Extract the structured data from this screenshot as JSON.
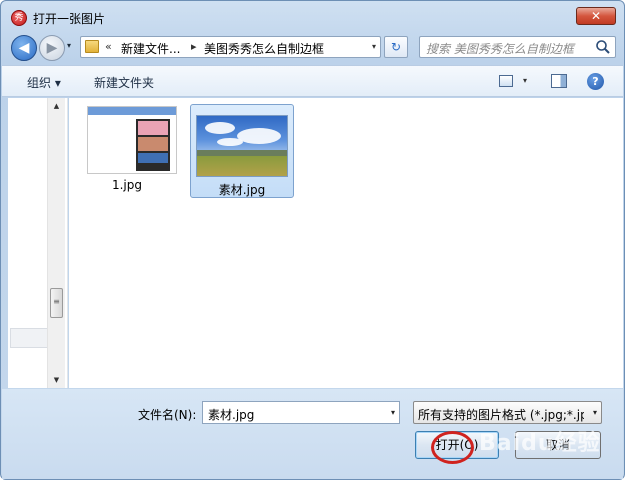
{
  "window": {
    "title": "打开一张图片",
    "close_label": "✕",
    "app_icon_glyph": "秀"
  },
  "nav": {
    "back_glyph": "◀",
    "forward_glyph": "▶",
    "dropdown_glyph": "▾"
  },
  "address": {
    "overflow_glyph": "«",
    "crumbs": [
      "新建文件...",
      "美图秀秀怎么自制边框"
    ],
    "separator_glyph": "▸",
    "dropdown_glyph": "▾"
  },
  "refresh_glyph": "↻",
  "search": {
    "placeholder": "搜索 美图秀秀怎么自制边框"
  },
  "toolbar": {
    "organize_label": "组织 ▾",
    "new_folder_label": "新建文件夹",
    "view_arrow_glyph": "▾",
    "help_glyph": "?"
  },
  "scroll": {
    "up_glyph": "▲",
    "down_glyph": "▼",
    "thumb_glyph": "≡"
  },
  "files": [
    {
      "name": "1.jpg",
      "selected": false
    },
    {
      "name": "素材.jpg",
      "selected": true
    }
  ],
  "bottom": {
    "filename_label": "文件名(N):",
    "filename_value": "素材.jpg",
    "filter_value": "所有支持的图片格式 (*.jpg;*.jp",
    "open_label": "打开(O)",
    "cancel_label": "取消",
    "dropdown_glyph": "▾"
  },
  "watermark": {
    "text": "Baidu经验"
  },
  "colors": {
    "highlight_circle": "#d0231f",
    "selection": "#c4ddf7"
  },
  "icons": [
    "app-icon",
    "back-arrow-icon",
    "forward-arrow-icon",
    "folder-icon",
    "refresh-icon",
    "search-icon",
    "view-icon",
    "preview-pane-icon",
    "help-icon"
  ]
}
